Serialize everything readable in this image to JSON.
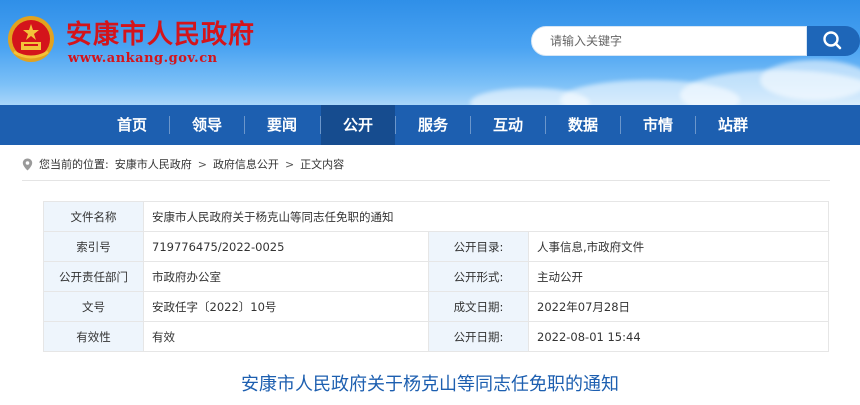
{
  "header": {
    "site_title": "安康市人民政府",
    "site_url": "www.ankang.gov.cn",
    "search_placeholder": "请输入关键字",
    "emblem_icon": "national-emblem-icon",
    "search_icon": "search-icon"
  },
  "nav": {
    "items": [
      {
        "label": "首页"
      },
      {
        "label": "领导"
      },
      {
        "label": "要闻"
      },
      {
        "label": "公开"
      },
      {
        "label": "服务"
      },
      {
        "label": "互动"
      },
      {
        "label": "数据"
      },
      {
        "label": "市情"
      },
      {
        "label": "站群"
      }
    ],
    "active": "公开"
  },
  "breadcrumb": {
    "prefix": "您当前的位置:",
    "items": [
      "安康市人民政府",
      "政府信息公开",
      "正文内容"
    ],
    "separator": ">"
  },
  "info": {
    "file_name_label": "文件名称",
    "file_name": "安康市人民政府关于杨克山等同志任免职的通知",
    "index_label": "索引号",
    "index": "719776475/2022-0025",
    "catalog_label": "公开目录:",
    "catalog": "人事信息,市政府文件",
    "dept_label": "公开责任部门",
    "dept": "市政府办公室",
    "form_label": "公开形式:",
    "form": "主动公开",
    "doc_no_label": "文号",
    "doc_no": "安政任字〔2022〕10号",
    "written_date_label": "成文日期:",
    "written_date": "2022年07月28日",
    "validity_label": "有效性",
    "validity": "有效",
    "publish_date_label": "公开日期:",
    "publish_date": "2022-08-01 15:44"
  },
  "document": {
    "title": "安康市人民政府关于杨克山等同志任免职的通知"
  },
  "colors": {
    "brand_red": "#d4141b",
    "nav_blue": "#1d5fb0",
    "label_bg": "#eef5fc"
  }
}
